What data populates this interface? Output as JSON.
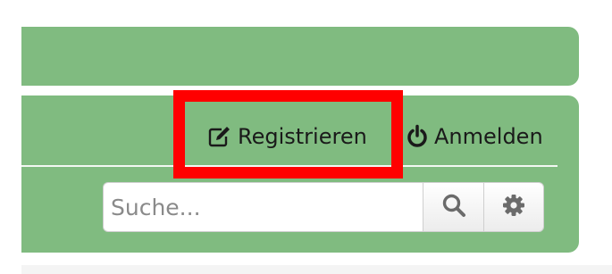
{
  "nav": {
    "register_label": "Registrieren",
    "login_label": "Anmelden"
  },
  "search": {
    "placeholder": "Suche..."
  },
  "icons": {
    "register": "pencil-square-icon",
    "login": "power-icon",
    "search": "magnifier-icon",
    "settings": "gear-icon"
  },
  "colors": {
    "panel": "#80bb80",
    "highlight": "#ff0000",
    "icon": "#1a1a1a",
    "button_icon": "#6b6b6b"
  }
}
